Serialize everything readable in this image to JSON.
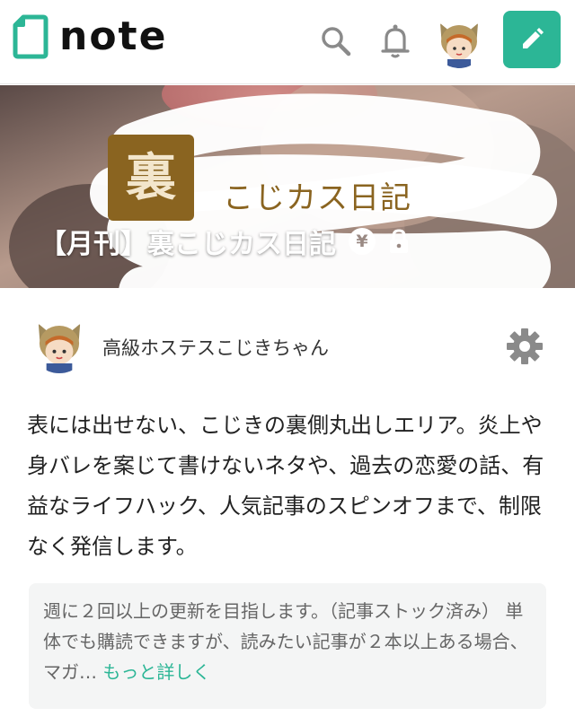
{
  "header": {
    "logo_text": "note",
    "icons": [
      "note-logo-icon",
      "search-icon",
      "bell-icon",
      "avatar",
      "pencil-icon"
    ],
    "accent_color": "#2cb696"
  },
  "hero": {
    "logo_char": "裏",
    "subtitle": "こじカス日記",
    "title": "【月刊】裏こじカス日記",
    "price_badge": "¥",
    "lock_icon": "lock-icon"
  },
  "author": {
    "name": "高級ホステスこじきちゃん",
    "settings_icon": "gear-icon"
  },
  "description": "表には出せない、こじきの裏側丸出しエリア。炎上や身バレを案じて書けないネタや、過去の恋愛の話、有益なライフハック、人気記事のスピンオフまで、制限なく発信します。",
  "notice": {
    "text": "週に２回以上の更新を目指します。（記事ストック済み） 単体でも購読できますが、読みたい記事が２本以上ある場合、マガ…",
    "more_label": "もっと詳しく"
  }
}
